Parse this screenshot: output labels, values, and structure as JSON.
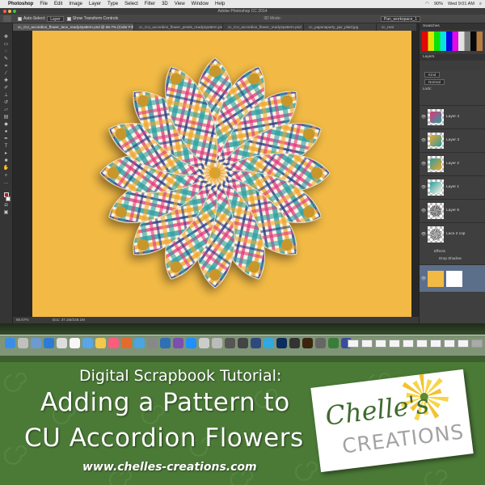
{
  "menubar": {
    "app": "Photoshop",
    "items": [
      "File",
      "Edit",
      "Image",
      "Layer",
      "Type",
      "Select",
      "Filter",
      "3D",
      "View",
      "Window",
      "Help"
    ],
    "battery": "90%",
    "clock": "Wed 9:01 AM"
  },
  "window": {
    "title": "Adobe Photoshop CC 2014"
  },
  "options": {
    "auto_select_label": "Auto-Select:",
    "auto_select_value": "Layer",
    "transform_label": "Show Transform Controls",
    "mode_3d": "3D Mode:",
    "workspace": "Pan_workspace_1"
  },
  "tabs": [
    {
      "label": "cc_CU_accordion_flower_lace_ready2pattern.psd @ 66.7% (Color Fill 1, RGB/8)",
      "active": true
    },
    {
      "label": "cc_CU_accordion_flower_petals_ready2pattern.psd"
    },
    {
      "label": "cc_CU_accordion_flower_ready2pattern.psd"
    },
    {
      "label": "cc_pajamaparty_ppr_plaid.jpg"
    },
    {
      "label": "cc_real"
    }
  ],
  "statusbar": {
    "zoom": "66.67%",
    "doc": "Doc: 37.1M/249.1M"
  },
  "panels": {
    "swatches_title": "Swatches",
    "layers_title": "Layers",
    "kind_label": "Kind",
    "blend_mode": "Normal",
    "lock_label": "Lock:",
    "layers": [
      {
        "name": "Layer 4"
      },
      {
        "name": "Layer 3"
      },
      {
        "name": "Layer 2"
      },
      {
        "name": "Layer 1"
      },
      {
        "name": "Layer 5"
      },
      {
        "name": "Lace 2 cop"
      },
      {
        "name": "Effects"
      },
      {
        "name": "Drop Shadow"
      }
    ]
  },
  "banner": {
    "subtitle": "Digital Scrapbook Tutorial:",
    "title_line1": "Adding a Pattern to",
    "title_line2": "CU Accordion Flowers",
    "url": "www.chelles-creations.com",
    "logo_line1": "Chelle's",
    "logo_line2": "CREATIONS"
  },
  "colors": {
    "canvas_bg": "#f2ba45",
    "banner_green": "#4b7a37",
    "logo_green": "#3f6a2e",
    "logo_gray": "#a3a3a3",
    "fg_color": "#c0191b"
  },
  "icons": {
    "dock": [
      "finder-icon",
      "launchpad-icon",
      "safari-icon",
      "mail-icon",
      "calendar-icon",
      "photoshop-icon",
      "illustrator-icon",
      "trash-icon"
    ]
  }
}
